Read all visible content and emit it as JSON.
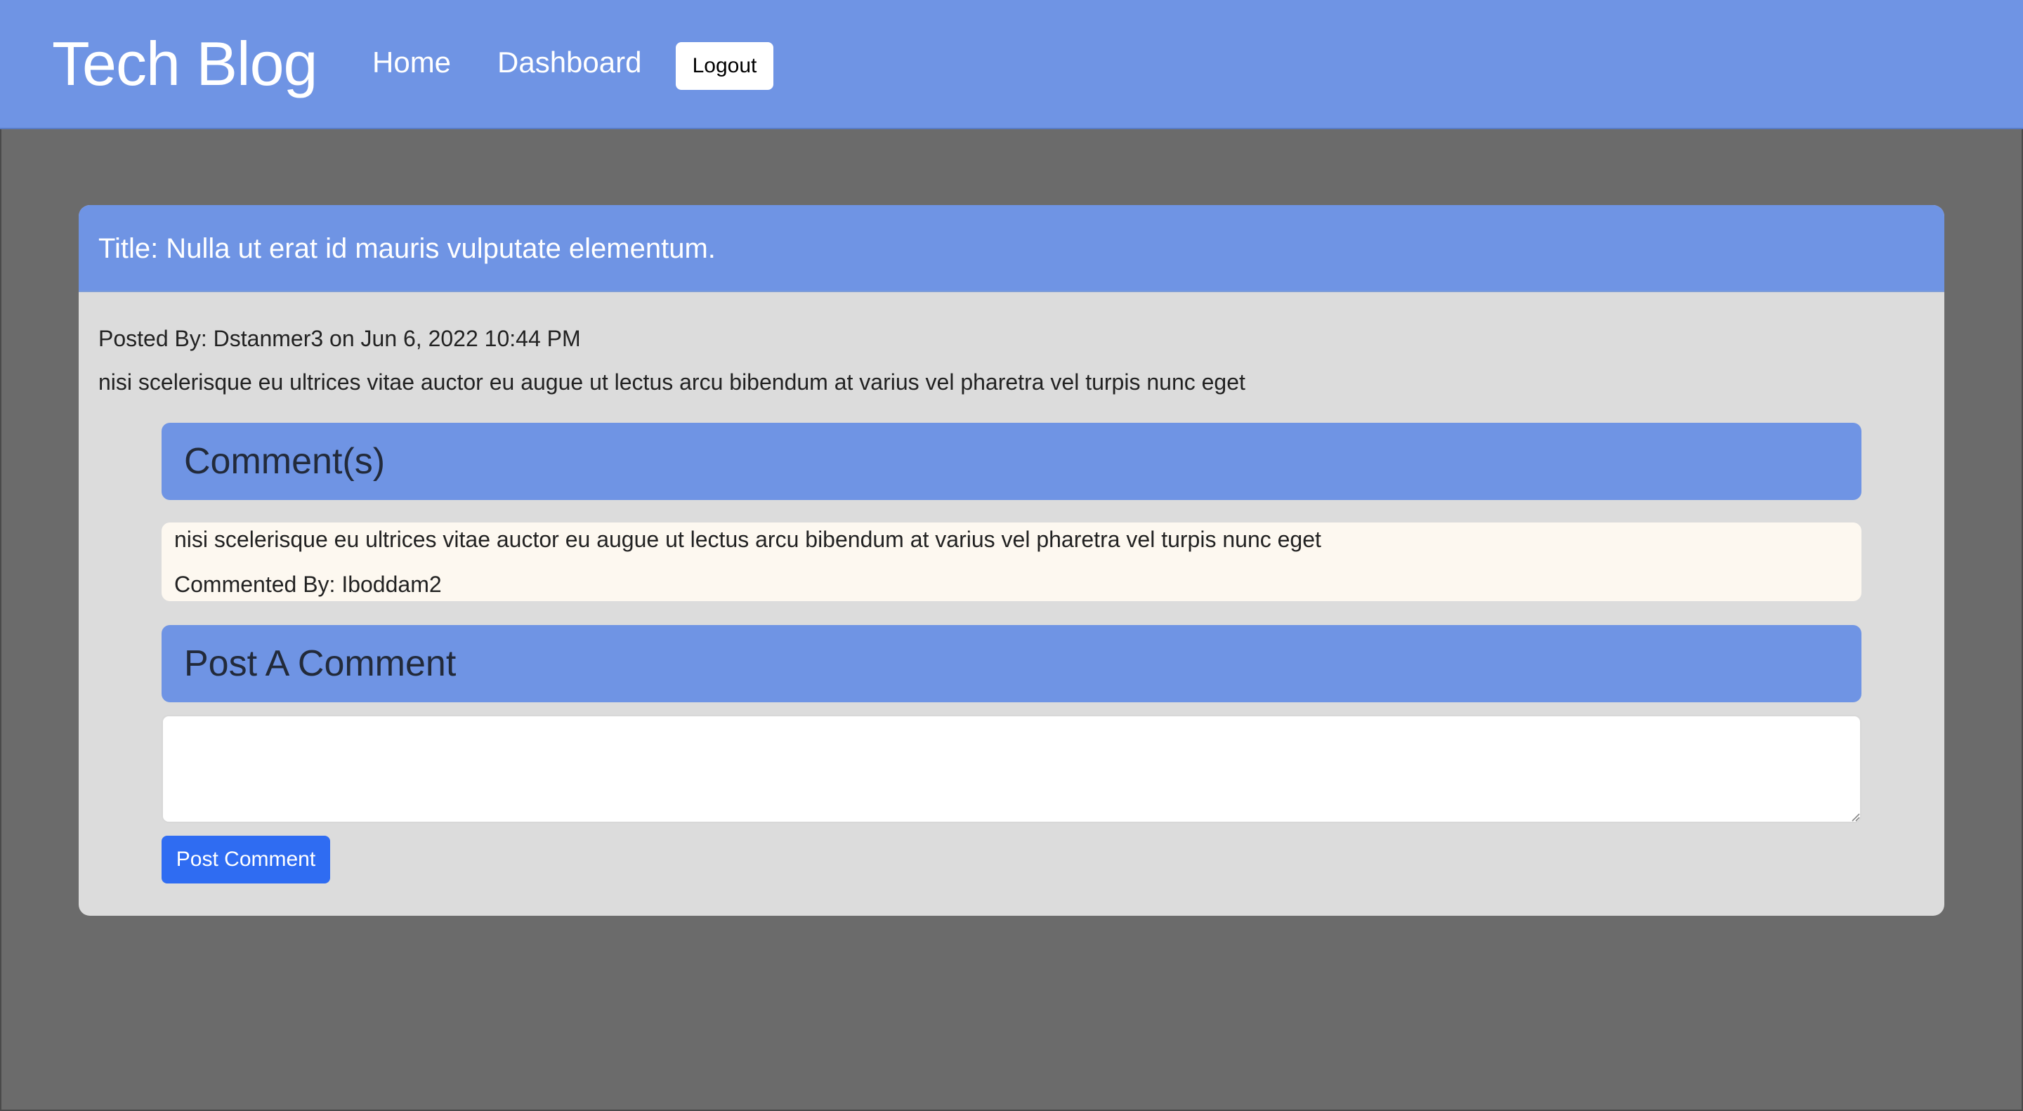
{
  "navbar": {
    "brand": "Tech Blog",
    "links": [
      "Home",
      "Dashboard"
    ],
    "logout_label": "Logout"
  },
  "post": {
    "title": "Title: Nulla ut erat id mauris vulputate elementum.",
    "meta": "Posted By: Dstanmer3 on Jun 6, 2022 10:44 PM",
    "body": "nisi scelerisque eu ultrices vitae auctor eu augue ut lectus arcu bibendum at varius vel pharetra vel turpis nunc eget"
  },
  "comments": {
    "heading": "Comment(s)",
    "items": [
      {
        "text": "nisi scelerisque eu ultrices vitae auctor eu augue ut lectus arcu bibendum at varius vel pharetra vel turpis nunc eget",
        "author": "Commented By: Iboddam2"
      }
    ]
  },
  "new_comment": {
    "heading": "Post A Comment",
    "value": "",
    "submit_label": "Post Comment"
  },
  "colors": {
    "accent": "#6f94e4",
    "page_background": "#6b6b6b",
    "card_background": "#dcdcdc",
    "comment_background": "#fdf8f0",
    "primary_button": "#2f6cf2"
  }
}
